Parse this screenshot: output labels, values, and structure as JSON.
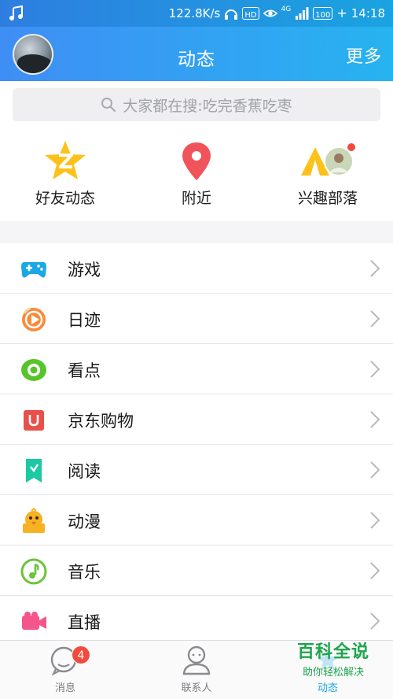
{
  "status_bar": {
    "speed": "122.8K/s",
    "hd": "HD",
    "network": "4G",
    "battery": "100",
    "time": "14:18"
  },
  "header": {
    "title": "动态",
    "more_label": "更多"
  },
  "search": {
    "placeholder": "大家都在搜:吃完香蕉吃枣"
  },
  "quick_entries": [
    {
      "label": "好友动态",
      "icon": "star-z-icon"
    },
    {
      "label": "附近",
      "icon": "location-pin-icon"
    },
    {
      "label": "兴趣部落",
      "icon": "tent-icon"
    }
  ],
  "list_items": [
    {
      "label": "游戏",
      "icon": "gamepad-icon",
      "color": "#1aa7e8"
    },
    {
      "label": "日迹",
      "icon": "play-circle-icon",
      "color": "#f68c3b"
    },
    {
      "label": "看点",
      "icon": "eye-icon",
      "color": "#57c42c"
    },
    {
      "label": "京东购物",
      "icon": "shopping-bag-icon",
      "color": "#e8504a"
    },
    {
      "label": "阅读",
      "icon": "book-icon",
      "color": "#1dc8a5"
    },
    {
      "label": "动漫",
      "icon": "cartoon-chick-icon",
      "color": "#f7b224"
    },
    {
      "label": "音乐",
      "icon": "music-note-icon",
      "color": "#6cc33b"
    },
    {
      "label": "直播",
      "icon": "video-camera-icon",
      "color": "#f4558a"
    }
  ],
  "bottom_nav": {
    "messages_label": "消息",
    "messages_badge": "4",
    "contacts_label": "联系人",
    "feed_label": "动态"
  },
  "watermark": {
    "title": "百科全说",
    "subtitle": "助你轻松解决"
  },
  "colors": {
    "header_start": "#3f8ef5",
    "header_end": "#27b3f0",
    "active_tab": "#1ba7e6",
    "badge": "#f24a3d"
  }
}
